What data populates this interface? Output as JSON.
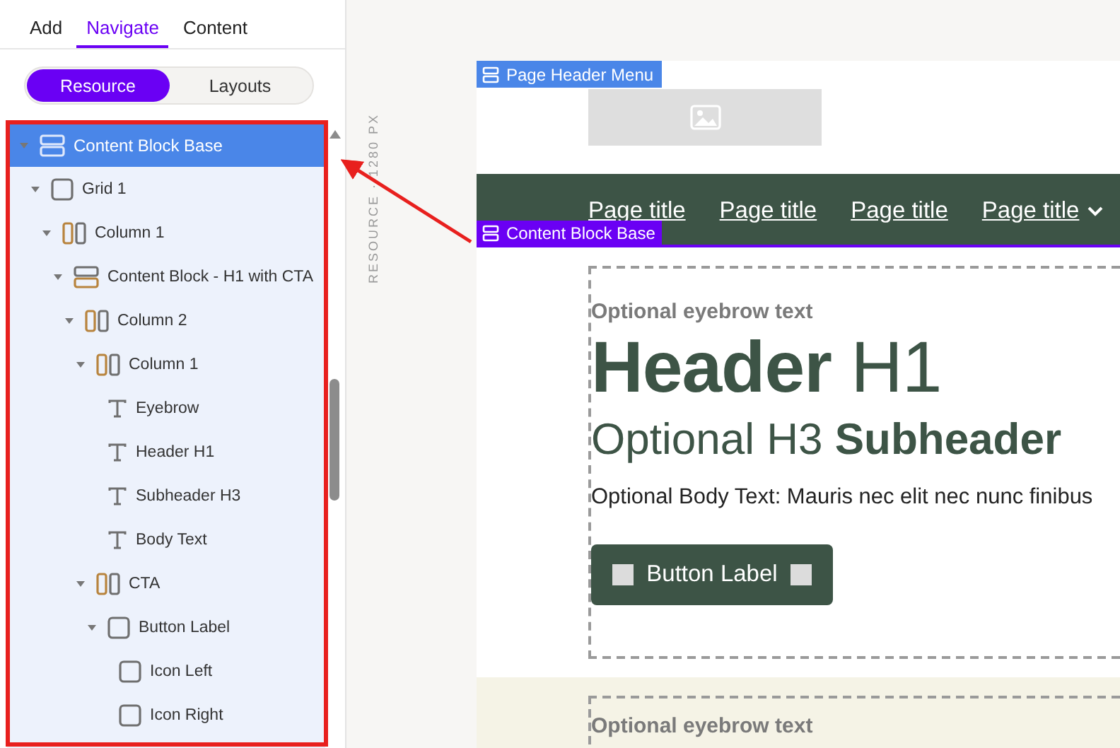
{
  "panel": {
    "tabs": [
      {
        "label": "Add",
        "selected": false
      },
      {
        "label": "Navigate",
        "selected": true
      },
      {
        "label": "Content",
        "selected": false
      }
    ],
    "segments": [
      {
        "label": "Resource",
        "selected": true
      },
      {
        "label": "Layouts",
        "selected": false
      }
    ],
    "tree": [
      {
        "label": "Content Block Base",
        "kind": "section",
        "selected": true,
        "children": [
          {
            "label": "Grid 1",
            "kind": "box",
            "selected": false,
            "children": [
              {
                "label": "Column 1",
                "kind": "columns",
                "selected": false,
                "children": [
                  {
                    "label": "Content Block - H1 with CTA",
                    "kind": "section",
                    "selected": false,
                    "children": [
                      {
                        "label": "Column 2",
                        "kind": "columns",
                        "selected": false,
                        "children": [
                          {
                            "label": "Column 1",
                            "kind": "columns",
                            "selected": false,
                            "children": [
                              {
                                "label": "Eyebrow",
                                "kind": "text",
                                "selected": false
                              },
                              {
                                "label": "Header H1",
                                "kind": "text",
                                "selected": false
                              },
                              {
                                "label": "Subheader H3",
                                "kind": "text",
                                "selected": false
                              },
                              {
                                "label": "Body Text",
                                "kind": "text",
                                "selected": false
                              }
                            ]
                          },
                          {
                            "label": "CTA",
                            "kind": "columns",
                            "selected": false,
                            "children": [
                              {
                                "label": "Button Label",
                                "kind": "box",
                                "selected": false,
                                "children": [
                                  {
                                    "label": "Icon Left",
                                    "kind": "box",
                                    "selected": false
                                  },
                                  {
                                    "label": "Icon Right",
                                    "kind": "box",
                                    "selected": false
                                  }
                                ]
                              }
                            ]
                          }
                        ]
                      }
                    ]
                  }
                ]
              }
            ]
          }
        ]
      }
    ]
  },
  "canvas": {
    "ruler_label": "RESOURCE · 1280 PX",
    "header": {
      "tag": "Page Header Menu",
      "nav": [
        {
          "label": "Page title",
          "kind": "link"
        },
        {
          "label": "Page title",
          "kind": "link"
        },
        {
          "label": "Page title",
          "kind": "link"
        },
        {
          "label": "Page title",
          "kind": "dropdown"
        }
      ]
    },
    "block": {
      "tag": "Content Block Base",
      "eyebrow": "Optional eyebrow text",
      "heading": "**Header** H1",
      "subheading": "Optional H3 **Subheader**",
      "body": "Optional Body Text: Mauris nec elit nec nunc finibus",
      "button": "Button Label"
    },
    "next_block": {
      "eyebrow": "Optional eyebrow text"
    }
  }
}
